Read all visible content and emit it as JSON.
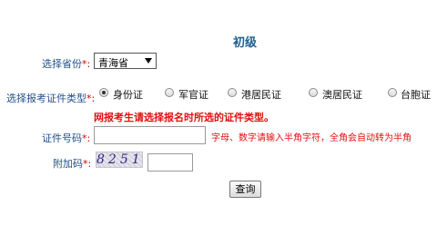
{
  "title": "初级",
  "province": {
    "label": "选择省份",
    "required_mark": "*:",
    "selected": "青海省"
  },
  "cert_type": {
    "label": "选择报考证件类型",
    "required_mark": "*:",
    "options": [
      {
        "label": "身份证",
        "checked": true
      },
      {
        "label": "军官证",
        "checked": false
      },
      {
        "label": "港居民证",
        "checked": false
      },
      {
        "label": "澳居民证",
        "checked": false
      },
      {
        "label": "台胞证",
        "checked": false
      }
    ]
  },
  "warning": "网报考生请选择报名时所选的证件类型。",
  "cert_number": {
    "label": "证件号码",
    "required_mark": "*:",
    "value": "",
    "hint": "字母、数字请输入半角字符，全角会自动转为半角"
  },
  "captcha": {
    "label": "附加码",
    "required_mark": "*:",
    "image_text": "8251",
    "value": ""
  },
  "submit_label": "查询"
}
